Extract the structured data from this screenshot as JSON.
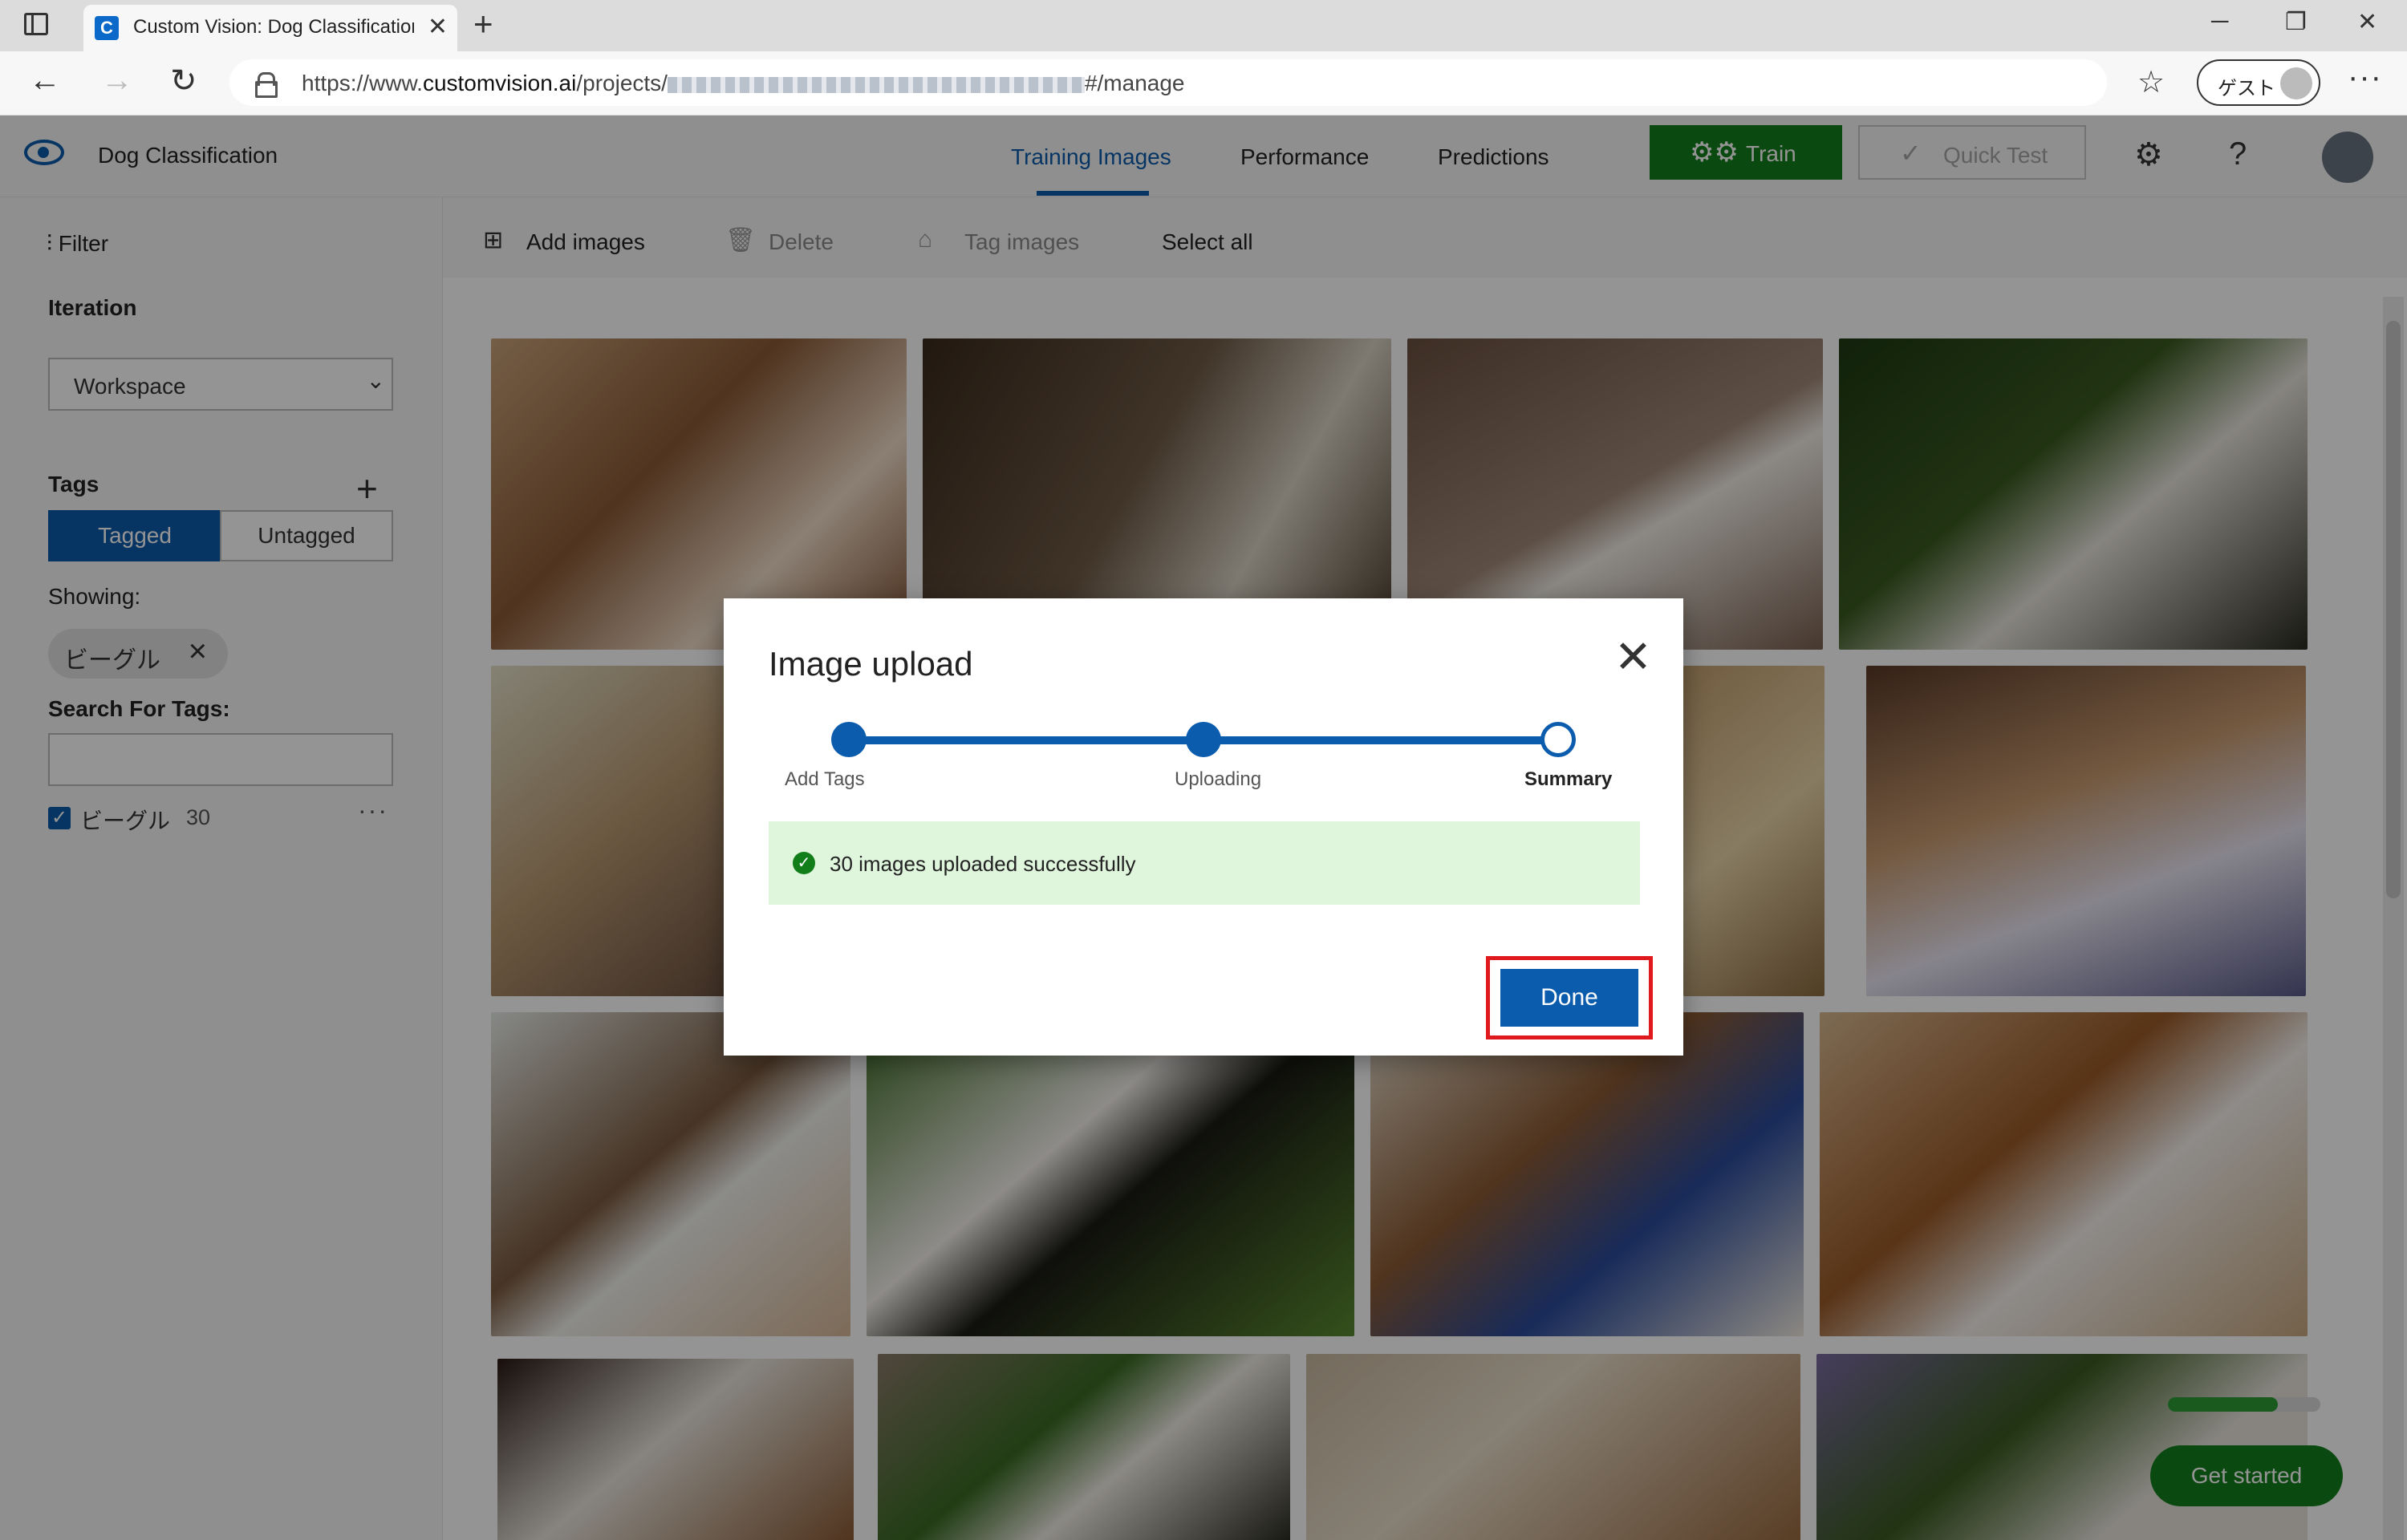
{
  "browser": {
    "tab_title": "Custom Vision: Dog Classification",
    "tab_close": "✕",
    "new_tab": "+",
    "url_prefix": "https://www.",
    "url_host": "customvision.ai",
    "url_path_start": "/projects/",
    "url_path_end": "#/manage",
    "profile_label": "ゲスト",
    "window_controls": [
      "─",
      "❐",
      "✕"
    ]
  },
  "app": {
    "project_name": "Dog Classification",
    "nav_tabs": [
      "Training Images",
      "Performance",
      "Predictions"
    ],
    "active_tab": "Training Images",
    "train_label": "Train",
    "quick_test_label": "Quick Test",
    "settings_glyph": "⚙",
    "help_glyph": "?"
  },
  "sidebar": {
    "filter_label": "Filter",
    "iteration_heading": "Iteration",
    "iteration_value": "Workspace",
    "tags_heading": "Tags",
    "tagged_label": "Tagged",
    "untagged_label": "Untagged",
    "showing_label": "Showing:",
    "showing_chip": "ビーグル",
    "search_heading": "Search For Tags:",
    "search_value": "",
    "tag_items": [
      {
        "name": "ビーグル",
        "count": "30",
        "checked": true
      }
    ]
  },
  "toolbar": {
    "add_images": "Add images",
    "delete": "Delete",
    "tag_images": "Tag images",
    "select_all": "Select all"
  },
  "onboarding": {
    "progress_fraction": 0.72,
    "get_started_label": "Get started"
  },
  "dialog": {
    "title": "Image upload",
    "steps": [
      "Add Tags",
      "Uploading",
      "Summary"
    ],
    "current_step": "Summary",
    "success_message": "30 images uploaded successfully",
    "done_label": "Done"
  },
  "colors": {
    "accent": "#0b5cad",
    "train_green": "#127e1a",
    "success_bg": "#dff6dd",
    "highlight_red": "#e0191e"
  }
}
